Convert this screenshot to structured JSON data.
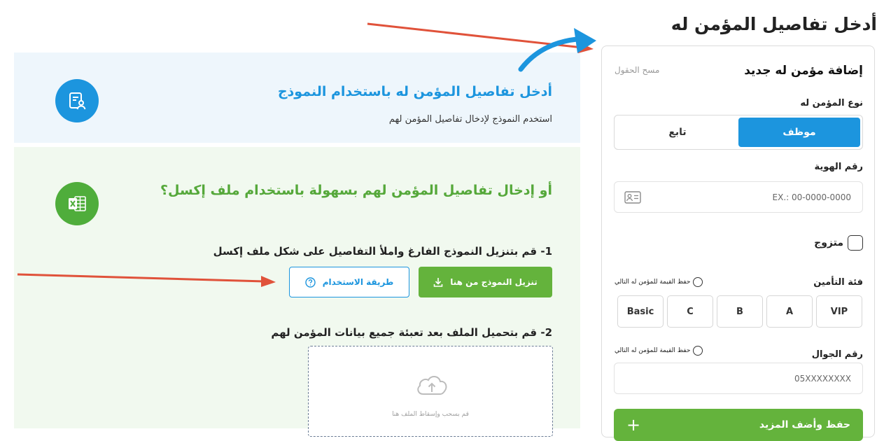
{
  "page_title": "أدخل تفاصيل المؤمن له",
  "form": {
    "title": "إضافة مؤمن له جديد",
    "clear_fields": "مسح الحقول",
    "insured_type_label": "نوع المؤمن له",
    "types": [
      "موظف",
      "تابع"
    ],
    "active_type": "موظف",
    "id_label": "رقم الهوية",
    "id_placeholder": "EX.: 00-0000-0000",
    "married_label": "متزوج",
    "insurance_class_label": "فئة التأمين",
    "save_for_next": "حفظ القيمة للمؤمن له التالي",
    "tiers": [
      "VIP",
      "A",
      "B",
      "C",
      "Basic"
    ],
    "mobile_label": "رقم الجوال",
    "mobile_placeholder": "05XXXXXXXX",
    "save_more_button": "حفظ وأضف المزيد"
  },
  "template_panel": {
    "heading": "أدخل تفاصيل المؤمن له باستخدام النموذج",
    "subtext": "استخدم النموذج لإدخال تفاصيل المؤمن لهم"
  },
  "excel_panel": {
    "heading": "أو إدخال تفاصيل المؤمن لهم بسهولة باستخدام ملف إكسل؟",
    "step1": "1- قم بتنزيل النموذج الفارغ واملأ التفاصيل على شكل ملف إكسل",
    "download_button": "تنزيل النموذج من هنا",
    "how_to_button": "طريقة الاستخدام",
    "step2": "2- قم بتحميل الملف بعد تعبئة جميع بيانات المؤمن لهم",
    "dropzone_text": "قم بسحب وإسقاط الملف هنا"
  },
  "colors": {
    "accent_blue": "#1c95de",
    "accent_green": "#64b33c",
    "arrow_red": "#e0523a"
  },
  "icons": [
    "user-document-icon",
    "excel-icon",
    "download-icon",
    "help-circle-icon",
    "id-card-icon",
    "cloud-upload-icon",
    "plus-icon"
  ]
}
